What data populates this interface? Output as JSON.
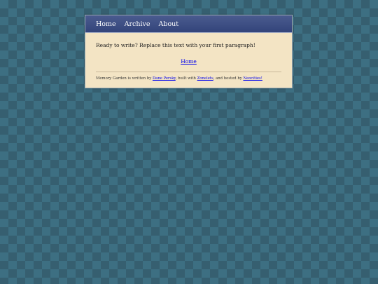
{
  "nav": {
    "items": [
      "Home",
      "Archive",
      "About"
    ]
  },
  "main": {
    "paragraph": "Ready to write? Replace this text with your first paragraph!",
    "home_link": "Home"
  },
  "footer": {
    "prefix": "Memory Garden is written by ",
    "author": "Dane Persky",
    "mid1": ", built with ",
    "tool": "Zonelets",
    "mid2": ", and hosted by ",
    "host": "Neocities!"
  },
  "colors": {
    "background": "#3d6f82",
    "nav": "#3d4f86",
    "content": "#f3e4c4",
    "link": "#0000ee"
  }
}
